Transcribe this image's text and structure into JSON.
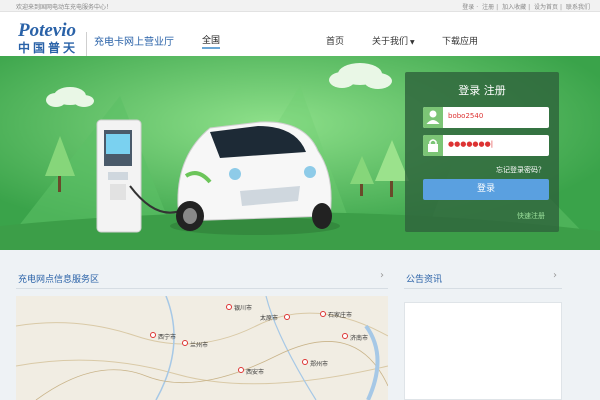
{
  "topbar": {
    "welcome": "欢迎来到国网电动车充电服务中心！",
    "links": [
      "登录",
      "注册",
      "加入收藏",
      "设为首页",
      "联系我们"
    ]
  },
  "header": {
    "logo_en": "Potevio",
    "logo_cn": "中国普天",
    "subtitle": "充电卡网上营业厅",
    "region": "全国",
    "nav": {
      "home": "首页",
      "about": "关于我们",
      "download": "下载应用"
    }
  },
  "login": {
    "title": "登录 注册",
    "username_value": "bobo2540",
    "password_value": "●●●●●●●|",
    "forgot": "忘记登录密码？",
    "login_button": "登录",
    "quick_register": "快速注册"
  },
  "sections": {
    "map_title": "充电网点信息服务区",
    "notice_title": "公告资讯"
  },
  "map": {
    "cities": [
      "银川市",
      "太原市",
      "石家庄市",
      "西宁市",
      "兰州市",
      "济南市",
      "西安市",
      "郑州市"
    ]
  },
  "colors": {
    "brand": "#2a62a8",
    "banner_green": "#4cb55a",
    "login_button": "#5aa0e0"
  }
}
